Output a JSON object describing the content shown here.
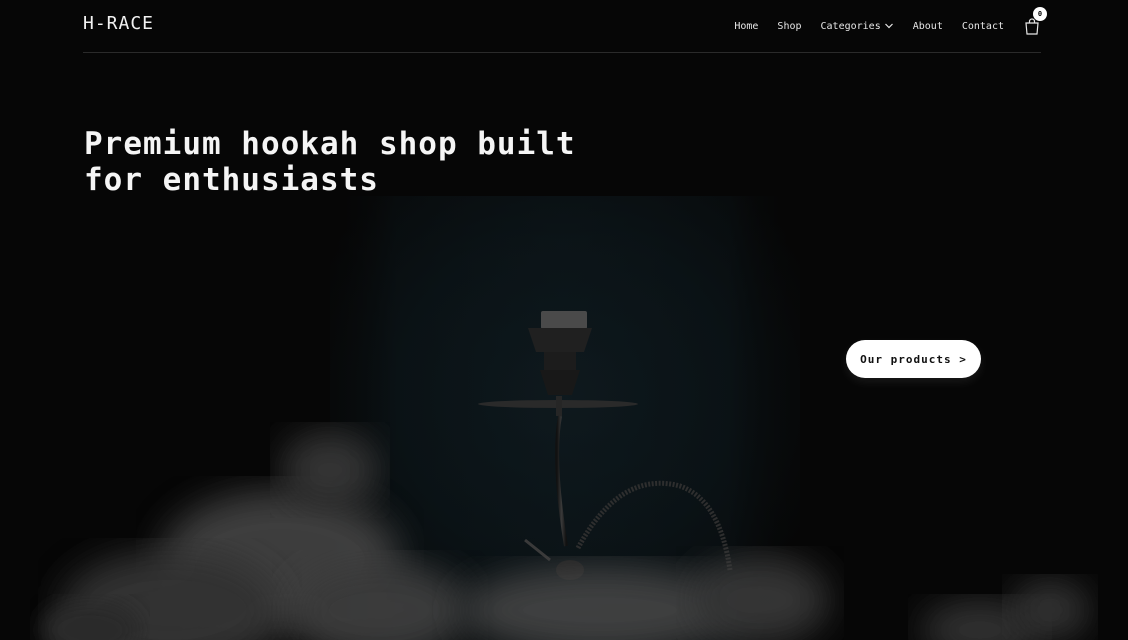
{
  "header": {
    "logo": "H-RACE",
    "nav": {
      "home": "Home",
      "shop": "Shop",
      "categories": "Categories",
      "about": "About",
      "contact": "Contact"
    },
    "cart_count": "0"
  },
  "hero": {
    "title": "Premium hookah shop built for enthusiasts",
    "cta_label": "Our products >"
  },
  "icons": {
    "categories_dropdown": "chevron-down-icon",
    "cart": "shopping-bag-icon"
  }
}
